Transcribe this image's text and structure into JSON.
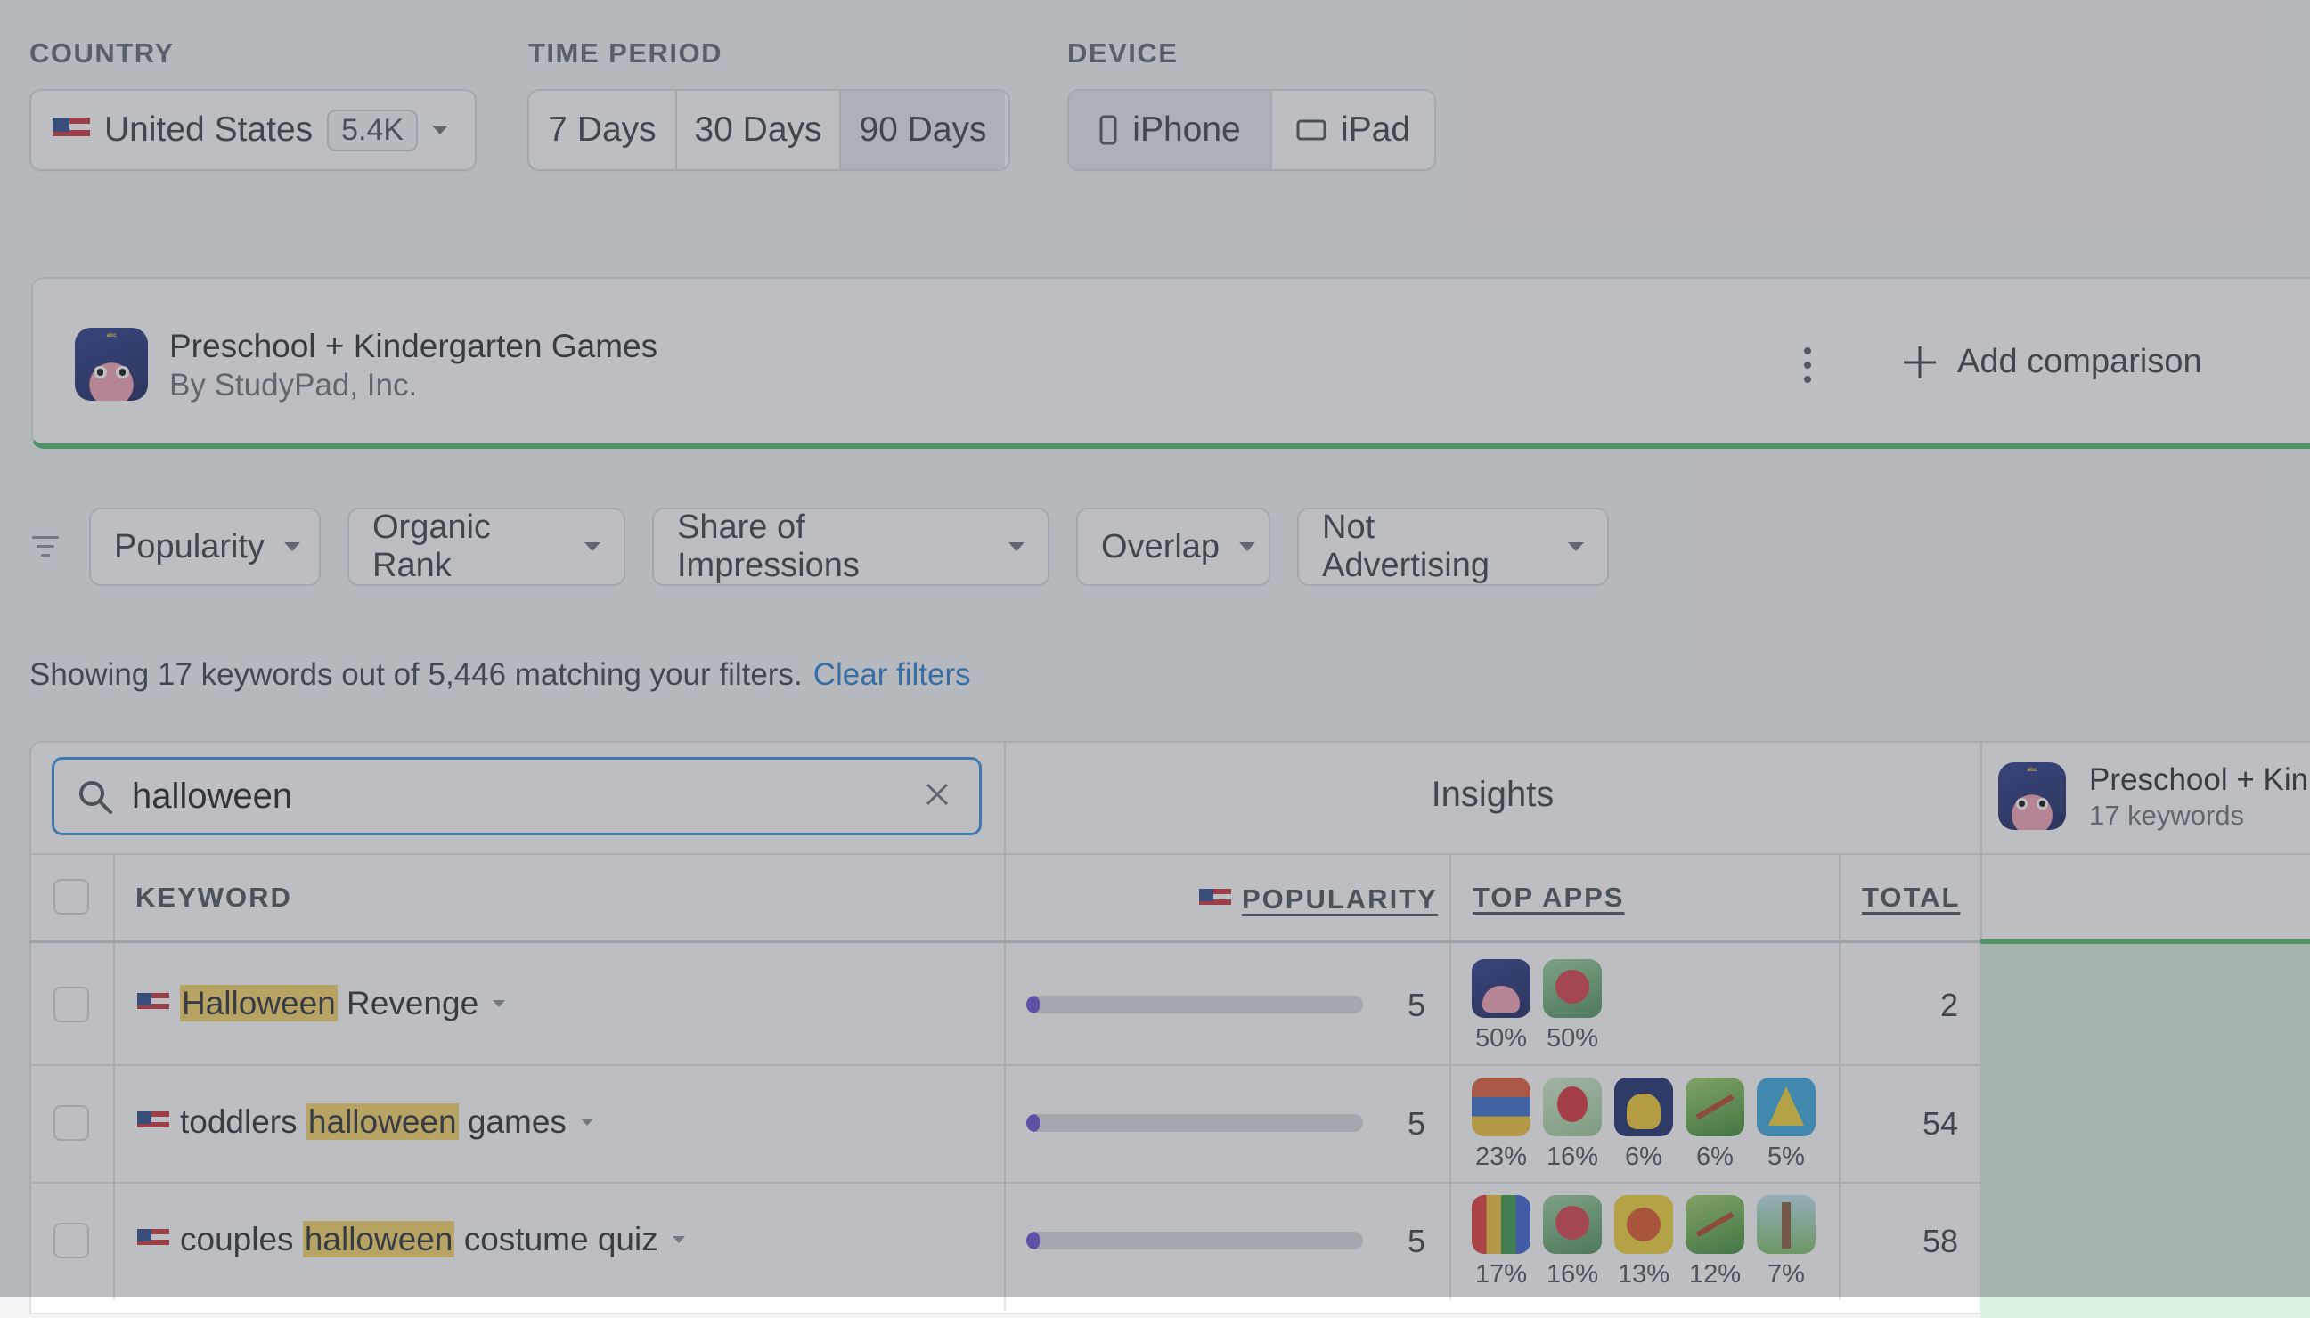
{
  "filters": {
    "country": {
      "label": "COUNTRY",
      "value": "United States",
      "count": "5.4K",
      "flag_icon": "us-flag-icon"
    },
    "time_period": {
      "label": "TIME PERIOD",
      "options": [
        "7 Days",
        "30 Days",
        "90 Days"
      ],
      "selected": "90 Days"
    },
    "device": {
      "label": "DEVICE",
      "options": [
        "iPhone",
        "iPad"
      ],
      "selected": "iPhone"
    }
  },
  "app_card": {
    "title": "Preschool + Kindergarten Games",
    "developer": "By StudyPad, Inc.",
    "add_comparison": "Add comparison",
    "accent_color": "#4fba6f"
  },
  "filter_pills": [
    "Popularity",
    "Organic Rank",
    "Share of Impressions",
    "Overlap",
    "Not Advertising"
  ],
  "summary": {
    "text": "Showing 17 keywords out of 5,446 matching your filters.",
    "clear_link": "Clear filters"
  },
  "table": {
    "search_value": "halloween",
    "insights_label": "Insights",
    "app_column": {
      "title": "Preschool + Kin",
      "subtitle": "17 keywords"
    },
    "headers": {
      "keyword": "KEYWORD",
      "popularity": "POPULARITY",
      "top_apps": "TOP APPS",
      "total": "TOTAL"
    },
    "rows": [
      {
        "keyword_parts": [
          {
            "text": "Halloween",
            "highlight": true
          },
          {
            "text": " Revenge",
            "highlight": false
          }
        ],
        "popularity": 5,
        "popularity_fraction": 0.04,
        "top_apps": [
          {
            "icon": "preschool-app-icon",
            "pct": "50%"
          },
          {
            "icon": "rose-app-icon",
            "pct": "50%"
          }
        ],
        "total": "2"
      },
      {
        "keyword_parts": [
          {
            "text": "toddlers ",
            "highlight": false
          },
          {
            "text": "halloween",
            "highlight": true
          },
          {
            "text": " games",
            "highlight": false
          }
        ],
        "popularity": 5,
        "popularity_fraction": 0.04,
        "top_apps": [
          {
            "icon": "block-puzzle-app-icon",
            "pct": "23%"
          },
          {
            "icon": "red-balloon-app-icon",
            "pct": "16%"
          },
          {
            "icon": "yellow-creature-app-icon",
            "pct": "6%"
          },
          {
            "icon": "archer-app-icon",
            "pct": "6%"
          },
          {
            "icon": "triangle-app-icon",
            "pct": "5%"
          }
        ],
        "total": "54"
      },
      {
        "keyword_parts": [
          {
            "text": "couples ",
            "highlight": false
          },
          {
            "text": "halloween",
            "highlight": true
          },
          {
            "text": " costume quiz",
            "highlight": false
          }
        ],
        "popularity": 5,
        "popularity_fraction": 0.04,
        "top_apps": [
          {
            "icon": "color-sort-app-icon",
            "pct": "17%"
          },
          {
            "icon": "rose-app-icon",
            "pct": "16%"
          },
          {
            "icon": "fruit-app-icon",
            "pct": "13%"
          },
          {
            "icon": "archer-app-icon",
            "pct": "12%"
          },
          {
            "icon": "tower-app-icon",
            "pct": "7%"
          }
        ],
        "total": "58"
      }
    ]
  },
  "colors": {
    "accent_green": "#4fba6f",
    "link_blue": "#2a7fd4",
    "popularity_bar": "#6a4fd6",
    "highlight": "#f7d66b"
  }
}
